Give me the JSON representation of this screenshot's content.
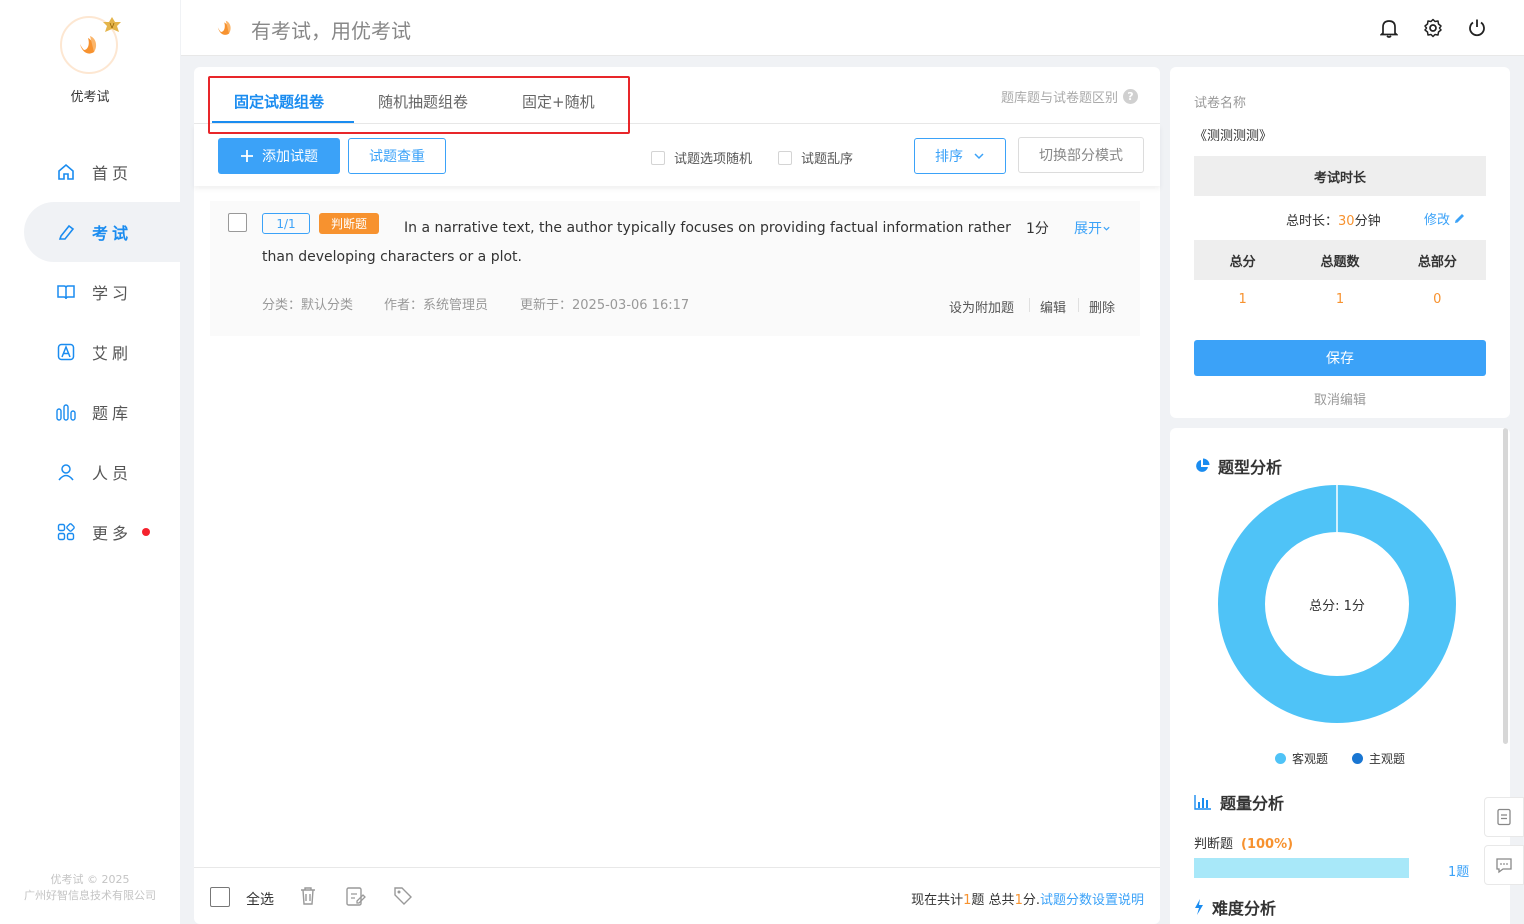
{
  "app": {
    "logo_name": "优考试",
    "slogan": "有考试，用优考试",
    "copyright_line1": "优考试 © 2025",
    "copyright_line2": "广州好智信息技术有限公司"
  },
  "sidebar": {
    "items": [
      {
        "label": "首页",
        "icon": "home-icon"
      },
      {
        "label": "考试",
        "icon": "exam-icon",
        "active": true
      },
      {
        "label": "学习",
        "icon": "book-icon"
      },
      {
        "label": "艾刷",
        "icon": "a-letter-icon"
      },
      {
        "label": "题库",
        "icon": "question-bank-icon"
      },
      {
        "label": "人员",
        "icon": "user-icon"
      },
      {
        "label": "更多",
        "icon": "apps-icon",
        "has_dot": true
      }
    ]
  },
  "header": {
    "icons": [
      "bell-icon",
      "gear-icon",
      "power-icon"
    ]
  },
  "tabs": {
    "items": [
      "固定试题组卷",
      "随机抽题组卷",
      "固定+随机"
    ],
    "active_index": 0,
    "help_link": "题库题与试卷题区别",
    "help_mark": "?"
  },
  "toolbar": {
    "add_button": "添加试题",
    "dedupe_button": "试题查重",
    "option_random": "试题选项随机",
    "question_shuffle": "试题乱序",
    "sort_button": "排序",
    "switch_mode_button": "切换部分模式"
  },
  "question": {
    "index": "1/1",
    "type": "判断题",
    "text": "In a narrative text, the author typically focuses on providing factual information rather than developing characters or a plot.",
    "score": "1分",
    "expand": "展开",
    "category": "分类：默认分类",
    "author": "作者：系统管理员",
    "updated": "更新于：2025-03-06 16:17",
    "actions": [
      "设为附加题",
      "编辑",
      "删除"
    ]
  },
  "bottom": {
    "select_all": "全选",
    "summary_prefix": "现在共计",
    "summary_count": "1",
    "summary_mid": "题 总共",
    "summary_score": "1",
    "summary_suffix": "分.",
    "summary_link": "试题分数设置说明"
  },
  "paper": {
    "name_label": "试卷名称",
    "name": "《测测测测》",
    "duration_header": "考试时长",
    "duration_label": "总时长：",
    "duration_value": "30",
    "duration_unit": "分钟",
    "edit_link": "修改",
    "stats_headers": [
      "总分",
      "总题数",
      "总部分"
    ],
    "stats_values": [
      "1",
      "1",
      "0"
    ],
    "save_button": "保存",
    "cancel_link": "取消编辑"
  },
  "analysis": {
    "type_title": "题型分析",
    "donut_center": "总分: 1分",
    "donut_segments": [
      {
        "name": "客观题",
        "value": 1,
        "color": "#4fc3f7"
      },
      {
        "name": "主观题",
        "value": 0,
        "color": "#1976d2"
      }
    ],
    "quantity_title": "题量分析",
    "quantity_rows": [
      {
        "label": "判断题",
        "percent": "(100%)",
        "fraction": 1.0,
        "count": "1题"
      }
    ],
    "difficulty_title": "难度分析"
  },
  "colors": {
    "accent": "#3ba2f8",
    "highlight": "#f7922f",
    "annotation_box": "#e8262a"
  }
}
